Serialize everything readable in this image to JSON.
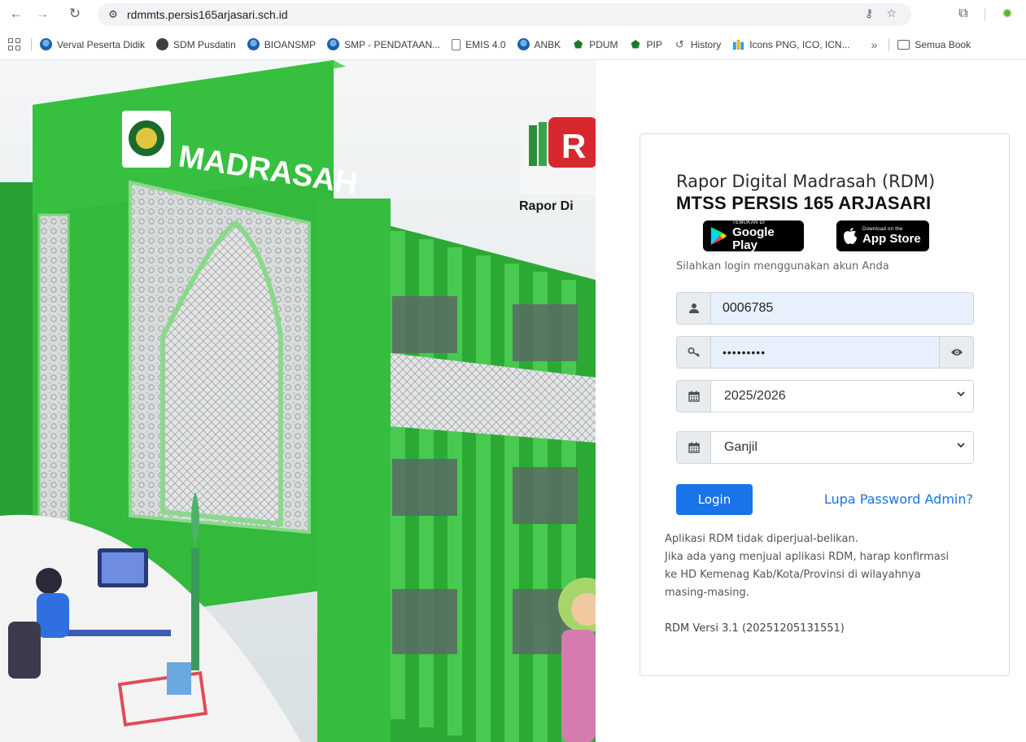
{
  "browser": {
    "url": "rdmmts.persis165arjasari.sch.id",
    "bookmarks": [
      {
        "label": "Verval Peserta Didik",
        "icon": "kemdikbud-icon"
      },
      {
        "label": "SDM Pusdatin",
        "icon": "dark-globe-icon"
      },
      {
        "label": "BIOANSMP",
        "icon": "kemdikbud-icon"
      },
      {
        "label": "SMP - PENDATAAN...",
        "icon": "kemdikbud-icon"
      },
      {
        "label": "EMIS 4.0",
        "icon": "document-icon"
      },
      {
        "label": "ANBK",
        "icon": "kemdikbud-icon"
      },
      {
        "label": "PDUM",
        "icon": "green-cap-icon"
      },
      {
        "label": "PIP",
        "icon": "green-cap-icon"
      },
      {
        "label": "History",
        "icon": "history-icon"
      },
      {
        "label": "Icons PNG, ICO, ICN...",
        "icon": "icons8-icon"
      }
    ],
    "more_label": "»",
    "folder_label": "Semua Book"
  },
  "hero": {
    "sign": "MADRASAH",
    "logo_partial": "Rapor Di"
  },
  "login": {
    "app_title": "Rapor Digital Madrasah (RDM)",
    "school_name": "MTSS PERSIS 165 ARJASARI",
    "google_play_small": "TEMUKAN DI",
    "google_play_big": "Google Play",
    "app_store_small": "Download on the",
    "app_store_big": "App Store",
    "instruction": "Silahkan login menggunakan akun Anda",
    "username_value": "0006785",
    "password_value": "•••••••••",
    "year_value": "2025/2026",
    "semester_value": "Ganjil",
    "login_button": "Login",
    "forgot_link": "Lupa Password Admin?",
    "notice_lines": [
      "Aplikasi RDM tidak diperjual-belikan.",
      "Jika ada yang menjual aplikasi RDM, harap konfirmasi",
      "ke HD Kemenag Kab/Kota/Provinsi di wilayahnya",
      "masing-masing."
    ],
    "version": "RDM Versi 3.1 (20251205131551)"
  },
  "colors": {
    "primary": "#1a73e8",
    "building_green": "#2fb53a",
    "input_autofill": "#e8f0fe"
  }
}
